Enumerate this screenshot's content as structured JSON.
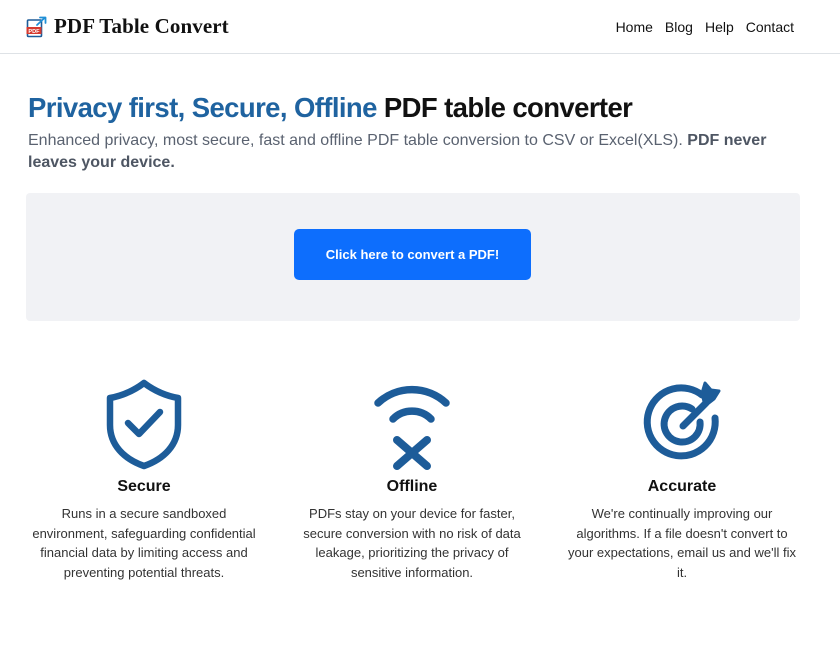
{
  "brand": {
    "name": "PDF Table Convert",
    "logo_text": "PDF",
    "logo_icon": "pdf-export-logo-icon"
  },
  "nav": {
    "items": [
      "Home",
      "Blog",
      "Help",
      "Contact"
    ]
  },
  "hero": {
    "title_accent": "Privacy first, Secure, Offline",
    "title_rest": "PDF table converter",
    "subtitle": "Enhanced privacy, most secure, fast and offline PDF table conversion to CSV or Excel(XLS).",
    "subtitle_bold": "PDF never leaves your device."
  },
  "cta": {
    "label": "Click here to convert a PDF!"
  },
  "features": [
    {
      "icon": "shield-check-icon",
      "title": "Secure",
      "text": "Runs in a secure sandboxed environment, safeguarding confidential financial data by limiting access and preventing potential threats."
    },
    {
      "icon": "wifi-off-icon",
      "title": "Offline",
      "text": "PDFs stay on your device for faster, secure conversion with no risk of data leakage, prioritizing the privacy of sensitive information."
    },
    {
      "icon": "target-arrow-icon",
      "title": "Accurate",
      "text": "We're continually improving our algorithms. If a file doesn't convert to your expectations, email us and we'll fix it."
    }
  ],
  "colors": {
    "accent": "#1f63a0",
    "button": "#0d6efd",
    "icon": "#1d5c99",
    "panel": "#f1f2f5"
  }
}
